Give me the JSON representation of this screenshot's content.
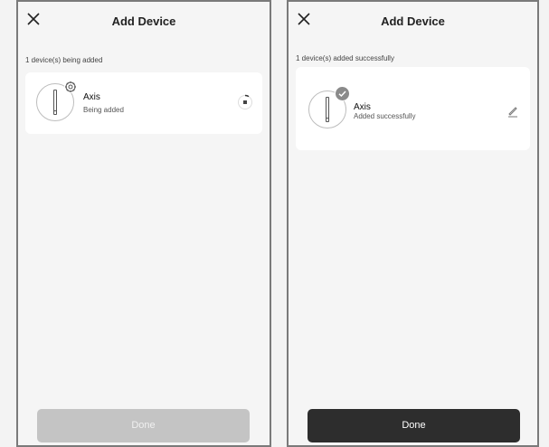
{
  "left_screen": {
    "title": "Add Device",
    "status": "1 device(s) being added",
    "device": {
      "name": "Axis",
      "status": "Being added",
      "badge_icon": "gear-icon"
    },
    "done_label": "Done",
    "done_enabled": false
  },
  "right_screen": {
    "title": "Add Device",
    "status": "1 device(s) added successfully",
    "device": {
      "name": "Axis",
      "status": "Added successfully",
      "badge_icon": "check-icon"
    },
    "done_label": "Done",
    "done_enabled": true
  },
  "colors": {
    "button_disabled": "#c4c4c4",
    "button_active": "#2d2d2d",
    "card": "#ffffff",
    "background": "#f5f5f5"
  }
}
